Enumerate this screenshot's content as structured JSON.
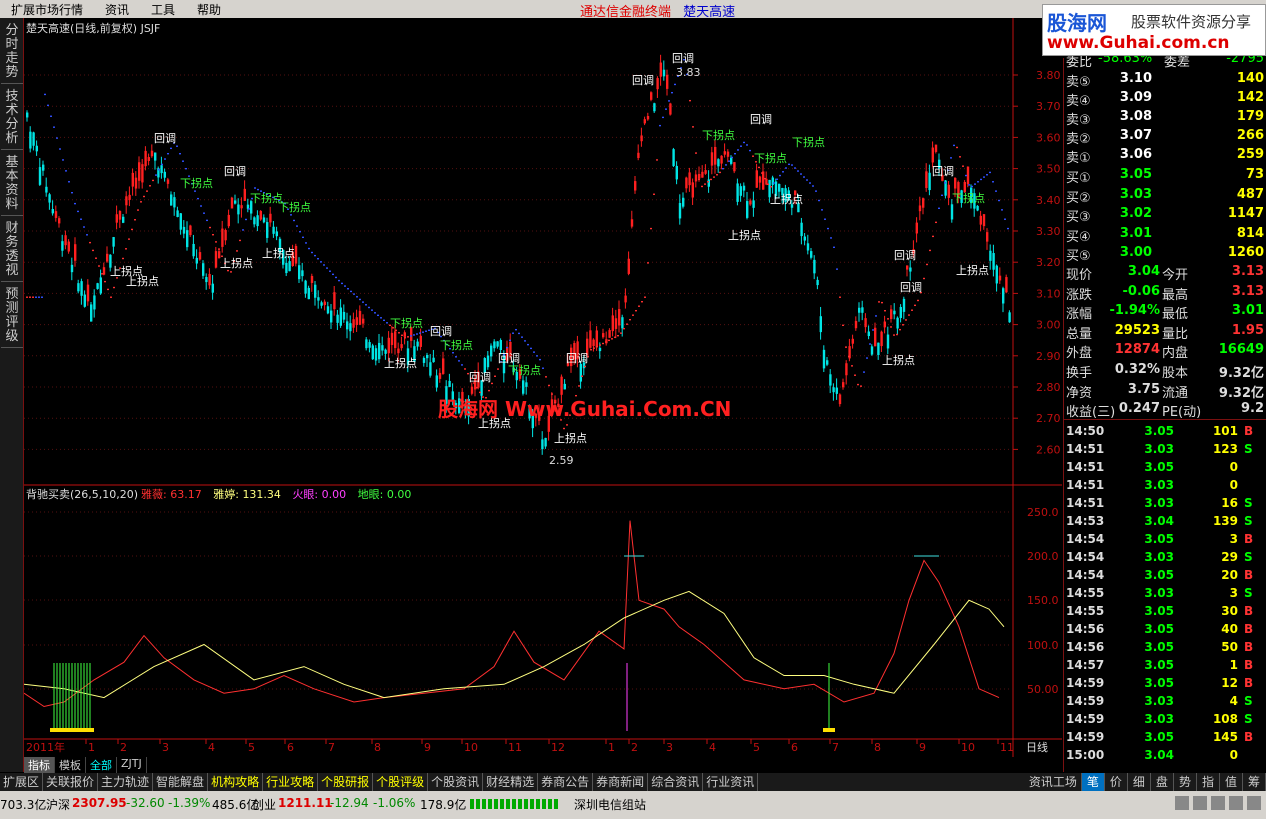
{
  "menu": {
    "items": [
      "扩展市场行情",
      "资讯",
      "工具",
      "帮助"
    ],
    "center_title": "通达信金融终端",
    "stock_title": "楚天高速"
  },
  "watermark": {
    "brand": "股海网",
    "tagline": "股票软件资源分享",
    "url": "www.Guhai.com.cn"
  },
  "side_tabs": [
    "分时走势",
    "技术分析",
    "基本资料",
    "财务透视",
    "预测评级"
  ],
  "main_chart": {
    "header": "楚天高速(日线,前复权) JSJF",
    "price_axis": [
      "3.80",
      "3.70",
      "3.60",
      "3.50",
      "3.40",
      "3.30",
      "3.20",
      "3.10",
      "3.00",
      "2.90",
      "2.80",
      "2.70",
      "2.60"
    ],
    "high_label": "3.83",
    "low_label": "2.59",
    "watermark_text": "股海网 Www.Guhai.Com.CN",
    "labels": {
      "pullback": "回调",
      "up_turn": "上拐点",
      "down_turn": "下拐点"
    }
  },
  "indicator": {
    "name": "背驰买卖(26,5,10,20)",
    "values": [
      {
        "label": "雅薇:",
        "value": "63.17",
        "color": "#ff3030"
      },
      {
        "label": "雅婷:",
        "value": "131.34",
        "color": "#ffff80"
      },
      {
        "label": "火眼:",
        "value": "0.00",
        "color": "#ff40ff"
      },
      {
        "label": "地眼:",
        "value": "0.00",
        "color": "#40ff40"
      }
    ],
    "axis": [
      "250.0",
      "200.0",
      "150.0",
      "100.0",
      "50.00"
    ]
  },
  "date_axis": {
    "year": "2011年",
    "months": [
      "1",
      "2",
      "3",
      "4",
      "5",
      "6",
      "7",
      "8",
      "9",
      "10",
      "11",
      "12",
      "1",
      "2",
      "3",
      "4",
      "5",
      "6",
      "7",
      "8",
      "9",
      "10",
      "11"
    ],
    "period": "日线"
  },
  "chart_tabs": [
    "指标",
    "模板",
    "全部",
    "ZJTJ"
  ],
  "quote": {
    "top_partial": {
      "label": "委比",
      "value": "-58.63%",
      "label2": "委差",
      "value2": "-2795"
    },
    "sells": [
      {
        "label": "卖⑤",
        "price": "3.10",
        "vol": "140"
      },
      {
        "label": "卖④",
        "price": "3.09",
        "vol": "142"
      },
      {
        "label": "卖③",
        "price": "3.08",
        "vol": "179"
      },
      {
        "label": "卖②",
        "price": "3.07",
        "vol": "266"
      },
      {
        "label": "卖①",
        "price": "3.06",
        "vol": "259"
      }
    ],
    "buys": [
      {
        "label": "买①",
        "price": "3.05",
        "vol": "73"
      },
      {
        "label": "买②",
        "price": "3.03",
        "vol": "487"
      },
      {
        "label": "买③",
        "price": "3.02",
        "vol": "1147"
      },
      {
        "label": "买④",
        "price": "3.01",
        "vol": "814"
      },
      {
        "label": "买⑤",
        "price": "3.00",
        "vol": "1260"
      }
    ],
    "stats": [
      {
        "l1": "现价",
        "v1": "3.04",
        "c1": "#0f0",
        "l2": "今开",
        "v2": "3.13",
        "c2": "#f33"
      },
      {
        "l1": "涨跌",
        "v1": "-0.06",
        "c1": "#0f0",
        "l2": "最高",
        "v2": "3.13",
        "c2": "#f33"
      },
      {
        "l1": "涨幅",
        "v1": "-1.94%",
        "c1": "#0f0",
        "l2": "最低",
        "v2": "3.01",
        "c2": "#0f0"
      },
      {
        "l1": "总量",
        "v1": "29523",
        "c1": "#ff0",
        "l2": "量比",
        "v2": "1.95",
        "c2": "#f33"
      },
      {
        "l1": "外盘",
        "v1": "12874",
        "c1": "#f33",
        "l2": "内盘",
        "v2": "16649",
        "c2": "#0f0"
      },
      {
        "l1": "换手",
        "v1": "0.32%",
        "c1": "#ddd",
        "l2": "股本",
        "v2": "9.32亿",
        "c2": "#ddd"
      },
      {
        "l1": "净资",
        "v1": "3.75",
        "c1": "#ddd",
        "l2": "流通",
        "v2": "9.32亿",
        "c2": "#ddd"
      },
      {
        "l1": "收益(三)",
        "v1": "0.247",
        "c1": "#ddd",
        "l2": "PE(动)",
        "v2": "9.2",
        "c2": "#ddd"
      }
    ],
    "ticks": [
      {
        "t": "14:50",
        "p": "3.05",
        "v": "101",
        "d": "B"
      },
      {
        "t": "14:51",
        "p": "3.03",
        "v": "123",
        "d": "S"
      },
      {
        "t": "14:51",
        "p": "3.05",
        "v": "0",
        "d": ""
      },
      {
        "t": "14:51",
        "p": "3.03",
        "v": "0",
        "d": ""
      },
      {
        "t": "14:51",
        "p": "3.03",
        "v": "16",
        "d": "S"
      },
      {
        "t": "14:53",
        "p": "3.04",
        "v": "139",
        "d": "S"
      },
      {
        "t": "14:54",
        "p": "3.05",
        "v": "3",
        "d": "B"
      },
      {
        "t": "14:54",
        "p": "3.03",
        "v": "29",
        "d": "S"
      },
      {
        "t": "14:54",
        "p": "3.05",
        "v": "20",
        "d": "B"
      },
      {
        "t": "14:55",
        "p": "3.03",
        "v": "3",
        "d": "S"
      },
      {
        "t": "14:55",
        "p": "3.05",
        "v": "30",
        "d": "B"
      },
      {
        "t": "14:56",
        "p": "3.05",
        "v": "40",
        "d": "B"
      },
      {
        "t": "14:56",
        "p": "3.05",
        "v": "50",
        "d": "B"
      },
      {
        "t": "14:57",
        "p": "3.05",
        "v": "1",
        "d": "B"
      },
      {
        "t": "14:59",
        "p": "3.05",
        "v": "12",
        "d": "B"
      },
      {
        "t": "14:59",
        "p": "3.03",
        "v": "4",
        "d": "S"
      },
      {
        "t": "14:59",
        "p": "3.03",
        "v": "108",
        "d": "S"
      },
      {
        "t": "14:59",
        "p": "3.05",
        "v": "145",
        "d": "B"
      },
      {
        "t": "15:00",
        "p": "3.04",
        "v": "0",
        "d": ""
      }
    ]
  },
  "bottom_tabs": [
    "扩展区",
    "关联报价",
    "主力轨迹",
    "智能解盘",
    "机构攻略",
    "行业攻略",
    "个股研报",
    "个股评级",
    "个股资讯",
    "财经精选",
    "券商公告",
    "券商新闻",
    "综合资讯",
    "行业资讯"
  ],
  "bottom_right_tabs": [
    "资讯工场",
    "笔",
    "价",
    "细",
    "盘",
    "势",
    "指",
    "值",
    "筹"
  ],
  "status": {
    "sh_amount": "703.3亿",
    "sz_label": "沪深",
    "sz_index": "2307.95",
    "sz_change": "-32.60",
    "sz_pct": "-1.39%",
    "sz_amount": "485.6亿",
    "cy_label": "创业",
    "cy_index": "1211.11",
    "cy_change": "-12.94",
    "cy_pct": "-1.06%",
    "cy_amount": "178.9亿",
    "server": "深圳电信组站"
  },
  "colors": {
    "up": "#ff2020",
    "down": "#00e5e5",
    "axis_red": "#c01010",
    "green_label": "#40ff40"
  }
}
